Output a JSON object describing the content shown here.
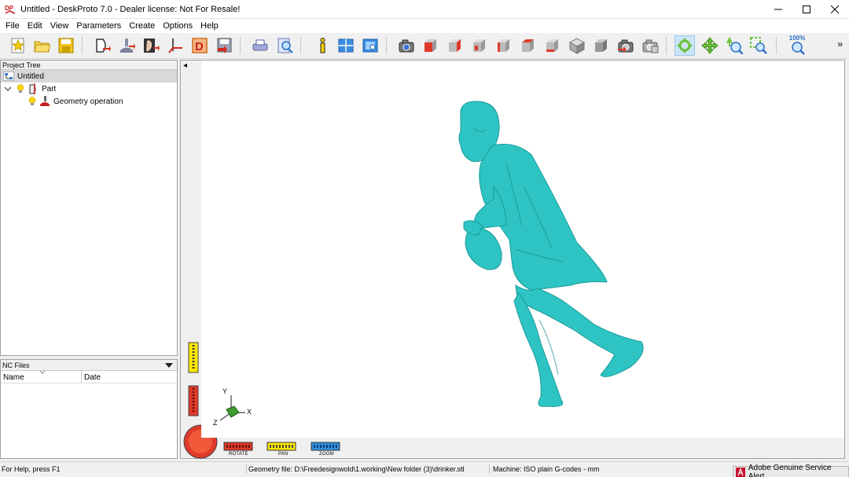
{
  "window": {
    "app_icon_text": "DP",
    "title": "Untitled - DeskProto 7.0 - Dealer license: Not For Resale!"
  },
  "menu": {
    "items": [
      "File",
      "Edit",
      "View",
      "Parameters",
      "Create",
      "Options",
      "Help"
    ]
  },
  "toolbar": {
    "zoom_level": "100%",
    "more": "»",
    "icons": [
      "new-project-icon",
      "open-folder-icon",
      "save-icon",
      "new-part-icon",
      "new-operation-icon",
      "import-geometry-icon",
      "toolpath-icon",
      "drawing-icon",
      "save-nc-icon",
      "print-icon",
      "print-preview-icon",
      "info-icon",
      "split-view-icon",
      "single-view-icon",
      "camera-view-icon",
      "view-front-icon",
      "view-right-icon",
      "view-back-icon",
      "view-left-icon",
      "view-top-icon",
      "view-bottom-icon",
      "view-iso-icon",
      "view-shaded-icon",
      "reset-view-icon",
      "view-extents-icon",
      "rotate-mode-icon",
      "pan-mode-icon",
      "zoom-mode-icon",
      "zoom-window-icon",
      "zoom-100-icon"
    ]
  },
  "project_tree": {
    "title": "Project Tree",
    "root": "Untitled",
    "part": "Part",
    "operation": "Geometry operation"
  },
  "nc_files": {
    "title": "NC Files",
    "columns": [
      "Name",
      "Date"
    ]
  },
  "viewport": {
    "collapse_glyph": "◂",
    "axes": {
      "x": "X",
      "y": "Y",
      "z": "Z"
    },
    "nav_buttons": {
      "rotate": "ROTATE",
      "pan": "PAN",
      "zoom": "ZOOM"
    },
    "colors": {
      "model": "#2ec4c4",
      "rotate": "#e03a2a",
      "pan": "#e6d300",
      "zoom": "#2f8fe0"
    }
  },
  "status": {
    "help": "For Help, press F1",
    "geometry_file": "Geometry file: D:\\Freedesignwold\\1.working\\New folder (3)\\drinker.stl",
    "machine": "Machine: ISO plain G-codes - mm",
    "alert": "Adobe Genuine Service Alert"
  }
}
